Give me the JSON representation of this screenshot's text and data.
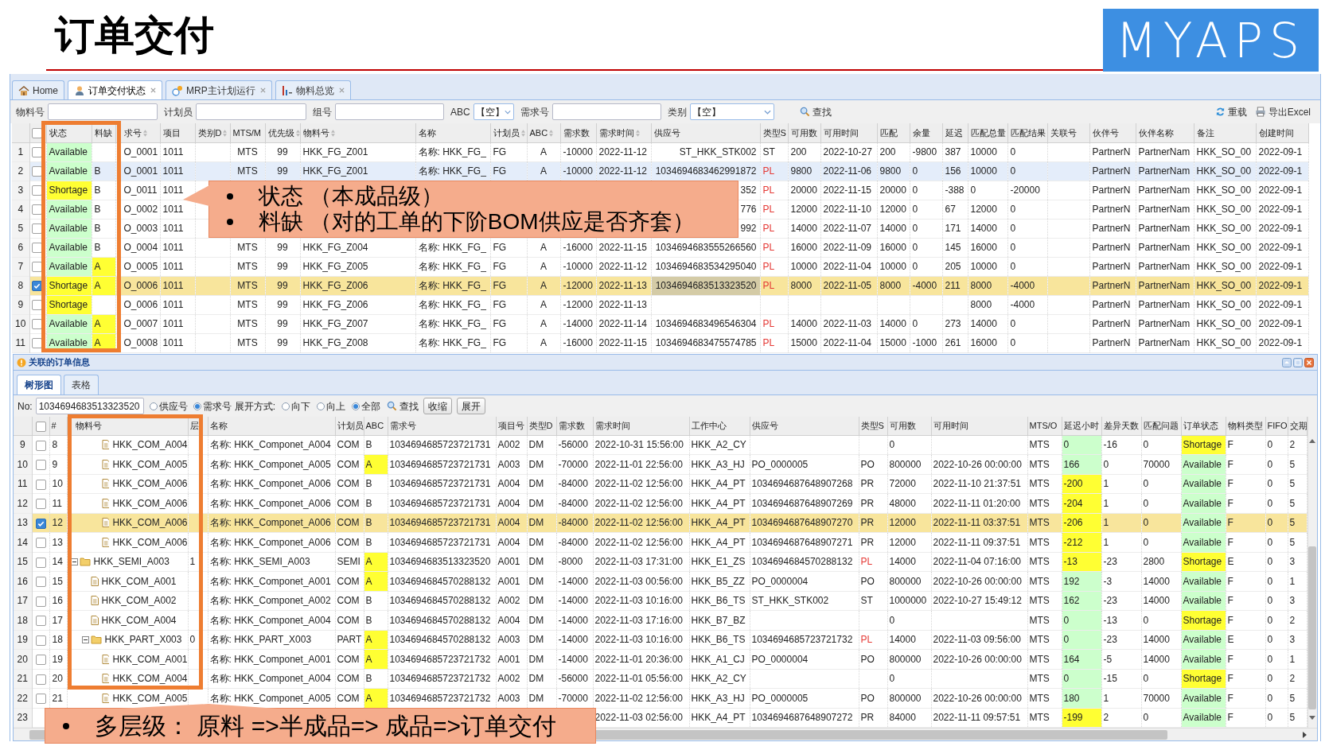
{
  "slide": {
    "title": "订单交付",
    "logo": "MYAPS"
  },
  "app_tabs": [
    {
      "kind": "home",
      "label": "Home",
      "selected": false,
      "closable": false
    },
    {
      "kind": "person",
      "label": "订单交付状态",
      "selected": true,
      "closable": true
    },
    {
      "kind": "mrp",
      "label": "MRP主计划运行",
      "selected": false,
      "closable": true
    },
    {
      "kind": "overview",
      "label": "物料总览",
      "selected": false,
      "closable": true
    }
  ],
  "filter_bar": {
    "fields": [
      {
        "kind": "text",
        "label": "物料号"
      },
      {
        "kind": "text",
        "label": "计划员"
      },
      {
        "kind": "text",
        "label": "组号"
      },
      {
        "kind": "select",
        "label": "ABC",
        "value": "【空】"
      },
      {
        "kind": "text",
        "label": "需求号"
      },
      {
        "kind": "select",
        "label": "类别",
        "value": "【空】"
      }
    ],
    "search": "查找",
    "actions": [
      {
        "kind": "reload",
        "label": "重载"
      },
      {
        "kind": "export",
        "label": "导出Excel"
      }
    ]
  },
  "order_grid": {
    "select_all_checked": false,
    "columns": [
      {
        "label": "状态"
      },
      {
        "label": "料缺"
      },
      {
        "label": "求号",
        "sortable": true
      },
      {
        "label": "项目"
      },
      {
        "label": "类别D",
        "sortable": true
      },
      {
        "label": "MTS/M"
      },
      {
        "label": "优先级",
        "sortable": true
      },
      {
        "label": "物料号",
        "sortable": true
      },
      {
        "label": "名称"
      },
      {
        "label": "计划员",
        "sortable": true
      },
      {
        "label": "ABC",
        "sortable": true
      },
      {
        "label": "需求数"
      },
      {
        "label": "需求时间",
        "sortable": true
      },
      {
        "label": "供应号"
      },
      {
        "label": "类型S"
      },
      {
        "label": "可用数"
      },
      {
        "label": "可用时间"
      },
      {
        "label": "匹配"
      },
      {
        "label": "余量"
      },
      {
        "label": "延迟"
      },
      {
        "label": "匹配总量"
      },
      {
        "label": "匹配结果"
      },
      {
        "label": "关联号"
      },
      {
        "label": "伙伴号"
      },
      {
        "label": "伙伴名称"
      },
      {
        "label": "备注"
      },
      {
        "label": "创建时间"
      }
    ],
    "rows": [
      {
        "number": "1",
        "checked": false,
        "selected": false,
        "hovered": false,
        "cells": [
          {
            "text": "Available",
            "color": "#ccffcc"
          },
          null,
          "O_0001",
          "1011",
          null,
          "MTS",
          "99",
          "HKK_FG_Z001",
          "名称: HKK_FG_",
          "FG",
          "A",
          "-10000",
          "2022-11-12",
          "ST_HKK_STK002",
          "ST",
          "200",
          "2022-10-27",
          "200",
          "-9800",
          "387",
          "10000",
          "0",
          null,
          "PartnerN",
          "PartnerNam",
          "HKK_SO_00",
          "2022-09-1"
        ]
      },
      {
        "number": "2",
        "checked": false,
        "selected": false,
        "hovered": true,
        "cells": [
          {
            "text": "Available",
            "color": "#ccffcc"
          },
          "B",
          "O_0001",
          "1011",
          null,
          "MTS",
          "99",
          "HKK_FG_Z001",
          "名称: HKK_FG_",
          "FG",
          "A",
          "-10000",
          "2022-11-12",
          "1034694683462991872",
          {
            "text": "PL",
            "kind": "alert"
          },
          "9800",
          "2022-11-06",
          "9800",
          "0",
          "156",
          "10000",
          "0",
          null,
          "PartnerN",
          "PartnerNam",
          "HKK_SO_00",
          "2022-09-1"
        ]
      },
      {
        "number": "3",
        "checked": false,
        "selected": false,
        "hovered": false,
        "cells": [
          {
            "text": "Shortage",
            "color": "#ffff33"
          },
          "B",
          "O_0011",
          "1011",
          null,
          null,
          null,
          null,
          null,
          null,
          null,
          null,
          null,
          "352",
          {
            "text": "PL",
            "kind": "alert"
          },
          "20000",
          "2022-11-15",
          "20000",
          "0",
          "-388",
          "0",
          "-20000",
          null,
          "PartnerN",
          "PartnerNam",
          "HKK_SO_00",
          "2022-09-1"
        ]
      },
      {
        "number": "4",
        "checked": false,
        "selected": false,
        "hovered": false,
        "cells": [
          {
            "text": "Available",
            "color": "#ccffcc"
          },
          "B",
          "O_0002",
          "1011",
          null,
          null,
          null,
          null,
          null,
          null,
          null,
          null,
          null,
          "776",
          {
            "text": "PL",
            "kind": "alert"
          },
          "12000",
          "2022-11-10",
          "12000",
          "0",
          "67",
          "12000",
          "0",
          null,
          "PartnerN",
          "PartnerNam",
          "HKK_SO_00",
          "2022-09-1"
        ]
      },
      {
        "number": "5",
        "checked": false,
        "selected": false,
        "hovered": false,
        "cells": [
          {
            "text": "Available",
            "color": "#ccffcc"
          },
          "B",
          "O_0003",
          "1011",
          null,
          null,
          null,
          null,
          null,
          null,
          null,
          null,
          null,
          "992",
          {
            "text": "PL",
            "kind": "alert"
          },
          "14000",
          "2022-11-07",
          "14000",
          "0",
          "171",
          "14000",
          "0",
          null,
          "PartnerN",
          "PartnerNam",
          "HKK_SO_00",
          "2022-09-1"
        ]
      },
      {
        "number": "6",
        "checked": false,
        "selected": false,
        "hovered": false,
        "cells": [
          {
            "text": "Available",
            "color": "#ccffcc"
          },
          "B",
          "O_0004",
          "1011",
          null,
          "MTS",
          "99",
          "HKK_FG_Z004",
          "名称: HKK_FG_",
          "FG",
          "A",
          "-16000",
          "2022-11-15",
          "1034694683555266560",
          {
            "text": "PL",
            "kind": "alert"
          },
          "16000",
          "2022-11-09",
          "16000",
          "0",
          "145",
          "16000",
          "0",
          null,
          "PartnerN",
          "PartnerNam",
          "HKK_SO_00",
          "2022-09-1"
        ]
      },
      {
        "number": "7",
        "checked": false,
        "selected": false,
        "hovered": false,
        "cells": [
          {
            "text": "Available",
            "color": "#ccffcc"
          },
          {
            "text": "A",
            "color": "#ffff33"
          },
          "O_0005",
          "1011",
          null,
          "MTS",
          "99",
          "HKK_FG_Z005",
          "名称: HKK_FG_",
          "FG",
          "A",
          "-10000",
          "2022-11-12",
          "1034694683534295040",
          {
            "text": "PL",
            "kind": "alert"
          },
          "10000",
          "2022-11-04",
          "10000",
          "0",
          "205",
          "10000",
          "0",
          null,
          "PartnerN",
          "PartnerNam",
          "HKK_SO_00",
          "2022-09-1"
        ]
      },
      {
        "number": "8",
        "checked": true,
        "selected": true,
        "hovered": false,
        "cells": [
          {
            "text": "Shortage",
            "color": "#ffff33"
          },
          {
            "text": "A",
            "color": "#ffff33"
          },
          "O_0006",
          "1011",
          null,
          "MTS",
          "99",
          "HKK_FG_Z006",
          "名称: HKK_FG_",
          "FG",
          "A",
          "-12000",
          "2022-11-13",
          {
            "text": "1034694683513323520",
            "color": "#d4cba6"
          },
          {
            "text": "PL",
            "kind": "alert"
          },
          "8000",
          "2022-11-05",
          "8000",
          "-4000",
          "211",
          "8000",
          "-4000",
          null,
          "PartnerN",
          "PartnerNam",
          "HKK_SO_00",
          "2022-09-1"
        ]
      },
      {
        "number": "9",
        "checked": false,
        "selected": false,
        "hovered": false,
        "cells": [
          {
            "text": "Shortage",
            "color": "#ffff33"
          },
          null,
          "O_0006",
          "1011",
          null,
          "MTS",
          "99",
          "HKK_FG_Z006",
          "名称: HKK_FG_",
          "FG",
          "A",
          "-12000",
          "2022-11-13",
          null,
          null,
          null,
          null,
          null,
          null,
          null,
          "8000",
          "-4000",
          null,
          "PartnerN",
          "PartnerNam",
          "HKK_SO_00",
          "2022-09-1"
        ]
      },
      {
        "number": "10",
        "checked": false,
        "selected": false,
        "hovered": false,
        "cells": [
          {
            "text": "Available",
            "color": "#ccffcc"
          },
          {
            "text": "A",
            "color": "#ffff33"
          },
          "O_0007",
          "1011",
          null,
          "MTS",
          "99",
          "HKK_FG_Z007",
          "名称: HKK_FG_",
          "FG",
          "A",
          "-14000",
          "2022-11-14",
          "1034694683496546304",
          {
            "text": "PL",
            "kind": "alert"
          },
          "14000",
          "2022-11-03",
          "14000",
          "0",
          "273",
          "14000",
          "0",
          null,
          "PartnerN",
          "PartnerNam",
          "HKK_SO_00",
          "2022-09-1"
        ]
      },
      {
        "number": "11",
        "checked": false,
        "selected": false,
        "hovered": false,
        "cells": [
          {
            "text": "Available",
            "color": "#ccffcc"
          },
          {
            "text": "A",
            "color": "#ffff33"
          },
          "O_0008",
          "1011",
          null,
          "MTS",
          "99",
          "HKK_FG_Z008",
          "名称: HKK_FG_",
          "FG",
          "A",
          "-16000",
          "2022-11-15",
          "1034694683475574785",
          {
            "text": "PL",
            "kind": "alert"
          },
          "15000",
          "2022-11-04",
          "15000",
          "-1000",
          "261",
          "16000",
          "0",
          null,
          "PartnerN",
          "PartnerNam",
          "HKK_SO_00",
          "2022-09-1"
        ]
      }
    ]
  },
  "related_panel": {
    "title": "关联的订单信息",
    "tabs": [
      {
        "label": "树形图",
        "selected": true
      },
      {
        "label": "表格",
        "selected": false
      }
    ],
    "toolbar": {
      "no_label": "No:",
      "no_value": "1034694683513323520",
      "search_by": [
        {
          "label": "供应号",
          "selected": false
        },
        {
          "label": "需求号",
          "selected": true
        }
      ],
      "expand_label": "展开方式:",
      "expand_modes": [
        {
          "label": "向下",
          "selected": false
        },
        {
          "label": "向上",
          "selected": false
        },
        {
          "label": "全部",
          "selected": true
        }
      ],
      "search": "查找",
      "buttons": [
        "收缩",
        "展开"
      ]
    },
    "tree_grid": {
      "select_all_checked": false,
      "columns": [
        {
          "label": "#"
        },
        {
          "label": "物料号"
        },
        {
          "label": "层"
        },
        {
          "label": "名称"
        },
        {
          "label": "计划员"
        },
        {
          "label": "ABC"
        },
        {
          "label": "需求号"
        },
        {
          "label": "项目号"
        },
        {
          "label": "类型D"
        },
        {
          "label": "需求数"
        },
        {
          "label": "需求时间"
        },
        {
          "label": "工作中心"
        },
        {
          "label": "供应号"
        },
        {
          "label": "类型S"
        },
        {
          "label": "可用数"
        },
        {
          "label": "可用时间"
        },
        {
          "label": "MTS/O"
        },
        {
          "label": "延迟小时"
        },
        {
          "label": "差异天数"
        },
        {
          "label": "匹配问题"
        },
        {
          "label": "订单状态"
        },
        {
          "label": "物料类型"
        },
        {
          "label": "FIFO"
        },
        {
          "label": "交期"
        }
      ],
      "rows": [
        {
          "children": [
            {
              "children": [
                {
                  "number": "9",
                  "index": "8",
                  "checked": false,
                  "selected": false,
                  "kind": "leaf",
                  "material": "HKK_COM_A004",
                  "cells": [
                    null,
                    "名称: HKK_Componet_A004",
                    "COM",
                    "B",
                    "1034694685723721731",
                    "A002",
                    "DM",
                    "-56000",
                    "2022-10-31 15:56:00",
                    "HKK_A2_CY",
                    null,
                    null,
                    "0",
                    null,
                    "MTS",
                    {
                      "text": "0",
                      "color": "#ccffcc"
                    },
                    "-16",
                    "0",
                    {
                      "text": "Shortage",
                      "color": "#ffff33"
                    },
                    "F",
                    "0",
                    "2"
                  ]
                },
                {
                  "number": "10",
                  "index": "9",
                  "checked": false,
                  "selected": false,
                  "kind": "leaf",
                  "material": "HKK_COM_A005",
                  "cells": [
                    null,
                    "名称: HKK_Componet_A005",
                    "COM",
                    {
                      "text": "A",
                      "color": "#ffff33"
                    },
                    "1034694685723721731",
                    "A003",
                    "DM",
                    "-70000",
                    "2022-11-01 22:56:00",
                    "HKK_A3_HJ",
                    "PO_0000005",
                    "PO",
                    "800000",
                    "2022-10-26 00:00:00",
                    "MTS",
                    {
                      "text": "166",
                      "color": "#ccffcc"
                    },
                    "0",
                    "70000",
                    {
                      "text": "Available",
                      "color": "#ccffcc"
                    },
                    "F",
                    "0",
                    "5"
                  ]
                },
                {
                  "number": "11",
                  "index": "10",
                  "checked": false,
                  "selected": false,
                  "kind": "leaf",
                  "material": "HKK_COM_A006",
                  "cells": [
                    null,
                    "名称: HKK_Componet_A006",
                    "COM",
                    "B",
                    "1034694685723721731",
                    "A004",
                    "DM",
                    "-84000",
                    "2022-11-02 12:56:00",
                    "HKK_A4_PT",
                    "1034694687648907268",
                    "PR",
                    "72000",
                    "2022-11-10 21:37:51",
                    "MTS",
                    {
                      "text": "-200",
                      "color": "#ffff33"
                    },
                    "1",
                    "0",
                    {
                      "text": "Available",
                      "color": "#ccffcc"
                    },
                    "F",
                    "0",
                    "5"
                  ]
                },
                {
                  "number": "12",
                  "index": "11",
                  "checked": false,
                  "selected": false,
                  "kind": "leaf",
                  "material": "HKK_COM_A006",
                  "cells": [
                    null,
                    "名称: HKK_Componet_A006",
                    "COM",
                    "B",
                    "1034694685723721731",
                    "A004",
                    "DM",
                    "-84000",
                    "2022-11-02 12:56:00",
                    "HKK_A4_PT",
                    "1034694687648907269",
                    "PR",
                    "48000",
                    "2022-11-11 01:20:00",
                    "MTS",
                    {
                      "text": "-204",
                      "color": "#ffff33"
                    },
                    "1",
                    "0",
                    {
                      "text": "Available",
                      "color": "#ccffcc"
                    },
                    "F",
                    "0",
                    "5"
                  ]
                },
                {
                  "number": "13",
                  "index": "12",
                  "checked": true,
                  "selected": true,
                  "kind": "leaf",
                  "material": "HKK_COM_A006",
                  "cells": [
                    null,
                    "名称: HKK_Componet_A006",
                    "COM",
                    "B",
                    "1034694685723721731",
                    "A004",
                    "DM",
                    "-84000",
                    "2022-11-02 12:56:00",
                    "HKK_A4_PT",
                    "1034694687648907270",
                    "PR",
                    "12000",
                    "2022-11-11 03:37:51",
                    "MTS",
                    {
                      "text": "-206",
                      "color": "#ffff33"
                    },
                    "1",
                    "0",
                    {
                      "text": "Available",
                      "color": "#ccffcc"
                    },
                    "F",
                    "0",
                    "5"
                  ]
                },
                {
                  "number": "14",
                  "index": "13",
                  "checked": false,
                  "selected": false,
                  "kind": "leaf",
                  "material": "HKK_COM_A006",
                  "cells": [
                    null,
                    "名称: HKK_Componet_A006",
                    "COM",
                    "B",
                    "1034694685723721731",
                    "A004",
                    "DM",
                    "-84000",
                    "2022-11-02 12:56:00",
                    "HKK_A4_PT",
                    "1034694687648907271",
                    "PR",
                    "12000",
                    "2022-11-11 09:37:51",
                    "MTS",
                    {
                      "text": "-212",
                      "color": "#ffff33"
                    },
                    "1",
                    "0",
                    {
                      "text": "Available",
                      "color": "#ccffcc"
                    },
                    "F",
                    "0",
                    "5"
                  ]
                }
              ]
            }
          ]
        },
        {
          "number": "15",
          "index": "14",
          "checked": false,
          "selected": false,
          "kind": "folder",
          "expanded": true,
          "material": "HKK_SEMI_A003",
          "cells": [
            "1",
            "名称: HKK_SEMI_A003",
            "SEMI",
            {
              "text": "A",
              "color": "#ffff33"
            },
            "1034694683513323520",
            "A001",
            "DM",
            "-8000",
            "2022-11-03 17:31:00",
            "HKK_E1_ZS",
            "1034694684570288132",
            {
              "text": "PL",
              "kind": "alert"
            },
            "14000",
            "2022-11-04 07:16:00",
            "MTS",
            {
              "text": "-13",
              "color": "#ffff33"
            },
            "-23",
            "2800",
            {
              "text": "Shortage",
              "color": "#ffff33"
            },
            "E",
            "0",
            "3"
          ],
          "children": [
            {
              "number": "16",
              "index": "15",
              "checked": false,
              "selected": false,
              "kind": "leaf",
              "material": "HKK_COM_A001",
              "cells": [
                null,
                "名称: HKK_Componet_A001",
                "COM",
                {
                  "text": "A",
                  "color": "#ffff33"
                },
                "1034694684570288132",
                "A001",
                "DM",
                "-14000",
                "2022-11-03 00:56:00",
                "HKK_B5_ZZ",
                "PO_0000004",
                "PO",
                "800000",
                "2022-10-26 00:00:00",
                "MTS",
                {
                  "text": "192",
                  "color": "#ccffcc"
                },
                "-3",
                "14000",
                {
                  "text": "Available",
                  "color": "#ccffcc"
                },
                "F",
                "0",
                "1"
              ]
            },
            {
              "number": "17",
              "index": "16",
              "checked": false,
              "selected": false,
              "kind": "leaf",
              "material": "HKK_COM_A002",
              "cells": [
                null,
                "名称: HKK_Componet_A002",
                "COM",
                "B",
                "1034694684570288132",
                "A002",
                "DM",
                "-14000",
                "2022-11-03 10:16:00",
                "HKK_B6_TS",
                "ST_HKK_STK002",
                "ST",
                "1000000",
                "2022-10-27 15:49:12",
                "MTS",
                {
                  "text": "162",
                  "color": "#ccffcc"
                },
                "-23",
                "14000",
                {
                  "text": "Available",
                  "color": "#ccffcc"
                },
                "F",
                "0",
                "3"
              ]
            },
            {
              "number": "18",
              "index": "17",
              "checked": false,
              "selected": false,
              "kind": "leaf",
              "material": "HKK_COM_A004",
              "cells": [
                null,
                "名称: HKK_Componet_A004",
                "COM",
                "B",
                "1034694684570288132",
                "A004",
                "DM",
                "-14000",
                "2022-11-03 17:16:00",
                "HKK_B7_BZ",
                null,
                null,
                "0",
                null,
                "MTS",
                {
                  "text": "0",
                  "color": "#ccffcc"
                },
                "-13",
                "0",
                {
                  "text": "Shortage",
                  "color": "#ffff33"
                },
                "F",
                "0",
                "2"
              ]
            },
            {
              "number": "19",
              "index": "18",
              "checked": false,
              "selected": false,
              "kind": "folder",
              "expanded": true,
              "material": "HKK_PART_X003",
              "cells": [
                "0",
                "名称: HKK_PART_X003",
                "PART",
                {
                  "text": "A",
                  "color": "#ffff33"
                },
                "1034694684570288132",
                "A003",
                "DM",
                "-14000",
                "2022-11-03 10:16:00",
                "HKK_B6_TS",
                "1034694685723721732",
                {
                  "text": "PL",
                  "kind": "alert"
                },
                "14000",
                "2022-11-03 09:56:00",
                "MTS",
                {
                  "text": "0",
                  "color": "#ccffcc"
                },
                "-23",
                "14000",
                {
                  "text": "Available",
                  "color": "#ccffcc"
                },
                "E",
                "0",
                "3"
              ],
              "children": [
                {
                  "number": "20",
                  "index": "19",
                  "checked": false,
                  "selected": false,
                  "kind": "leaf",
                  "material": "HKK_COM_A001",
                  "cells": [
                    null,
                    "名称: HKK_Componet_A001",
                    "COM",
                    {
                      "text": "A",
                      "color": "#ffff33"
                    },
                    "1034694685723721732",
                    "A001",
                    "DM",
                    "-14000",
                    "2022-11-01 20:36:00",
                    "HKK_A1_CJ",
                    "PO_0000004",
                    "PO",
                    "800000",
                    "2022-10-26 00:00:00",
                    "MTS",
                    {
                      "text": "164",
                      "color": "#ccffcc"
                    },
                    "-5",
                    "14000",
                    {
                      "text": "Available",
                      "color": "#ccffcc"
                    },
                    "F",
                    "0",
                    "1"
                  ]
                },
                {
                  "number": "21",
                  "index": "20",
                  "checked": false,
                  "selected": false,
                  "kind": "leaf",
                  "material": "HKK_COM_A004",
                  "cells": [
                    null,
                    "名称: HKK_Componet_A004",
                    "COM",
                    "B",
                    "1034694685723721732",
                    "A002",
                    "DM",
                    "-56000",
                    "2022-11-01 05:56:00",
                    "HKK_A2_CY",
                    null,
                    null,
                    "0",
                    null,
                    "MTS",
                    {
                      "text": "0",
                      "color": "#ccffcc"
                    },
                    "-15",
                    "0",
                    {
                      "text": "Shortage",
                      "color": "#ffff33"
                    },
                    "F",
                    "0",
                    "2"
                  ]
                },
                {
                  "number": "22",
                  "index": "21",
                  "checked": false,
                  "selected": false,
                  "kind": "leaf",
                  "material": "HKK_COM_A005",
                  "cells": [
                    null,
                    "名称: HKK_Componet_A005",
                    "COM",
                    {
                      "text": "A",
                      "color": "#ffff33"
                    },
                    "1034694685723721732",
                    "A003",
                    "DM",
                    "-70000",
                    "2022-11-02 12:56:00",
                    "HKK_A3_HJ",
                    "PO_0000005",
                    "PO",
                    "800000",
                    "2022-10-26 00:00:00",
                    "MTS",
                    {
                      "text": "180",
                      "color": "#ccffcc"
                    },
                    "1",
                    "70000",
                    {
                      "text": "Available",
                      "color": "#ccffcc"
                    },
                    "F",
                    "0",
                    "5"
                  ]
                },
                {
                  "number": "23",
                  "selected": false,
                  "cells": [
                    null,
                    null,
                    null,
                    null,
                    null,
                    null,
                    null,
                    null,
                    "2022-11-03 02:56:00",
                    "HKK_A4_PT",
                    "1034694687648907272",
                    "PR",
                    "84000",
                    "2022-11-11 09:57:51",
                    "MTS",
                    {
                      "text": "-199",
                      "color": "#ffff33"
                    },
                    "2",
                    "0",
                    {
                      "text": "Available",
                      "color": "#ccffcc"
                    },
                    "F",
                    "0",
                    "5"
                  ]
                }
              ]
            }
          ]
        }
      ]
    }
  },
  "callouts": [
    {
      "bullets": [
        "状态 （本成品级）",
        "料缺 （对的工单的下阶BOM供应是否齐套）"
      ]
    },
    {
      "bullets": [
        "多层级： 原料 =>半成品=> 成品=>订单交付"
      ]
    }
  ]
}
